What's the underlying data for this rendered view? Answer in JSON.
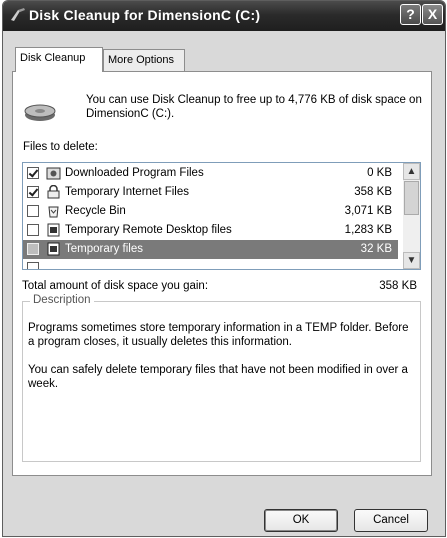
{
  "window": {
    "title": "Disk Cleanup for DimensionC (C:)",
    "help_label": "?",
    "close_label": "X"
  },
  "tabs": [
    {
      "label": "Disk Cleanup",
      "active": true
    },
    {
      "label": "More Options",
      "active": false
    }
  ],
  "intro_text": "You can use Disk Cleanup to free up to 4,776 KB of disk space on DimensionC (C:).",
  "files_label": "Files to delete:",
  "files": [
    {
      "name": "Downloaded Program Files",
      "size": "0 KB",
      "checked": true,
      "icon": "folder-gear-icon"
    },
    {
      "name": "Temporary Internet Files",
      "size": "358 KB",
      "checked": true,
      "icon": "lock-icon"
    },
    {
      "name": "Recycle Bin",
      "size": "3,071 KB",
      "checked": false,
      "icon": "recycle-bin-icon"
    },
    {
      "name": "Temporary Remote Desktop files",
      "size": "1,283 KB",
      "checked": false,
      "icon": "file-icon"
    },
    {
      "name": "Temporary files",
      "size": "32 KB",
      "checked": false,
      "icon": "file-icon",
      "selected": true
    }
  ],
  "total_label": "Total amount of disk space you gain:",
  "total_value": "358 KB",
  "description": {
    "legend": "Description",
    "paragraph1": "Programs sometimes store temporary information in a TEMP folder. Before a program closes, it usually deletes this information.",
    "paragraph2": "You can safely delete temporary files that have not been modified in over a week."
  },
  "buttons": {
    "ok": "OK",
    "cancel": "Cancel"
  },
  "colors": {
    "titlebar": "#2b2b2b",
    "selection": "#7a7a7a",
    "window_bg": "#d9d9d9"
  }
}
